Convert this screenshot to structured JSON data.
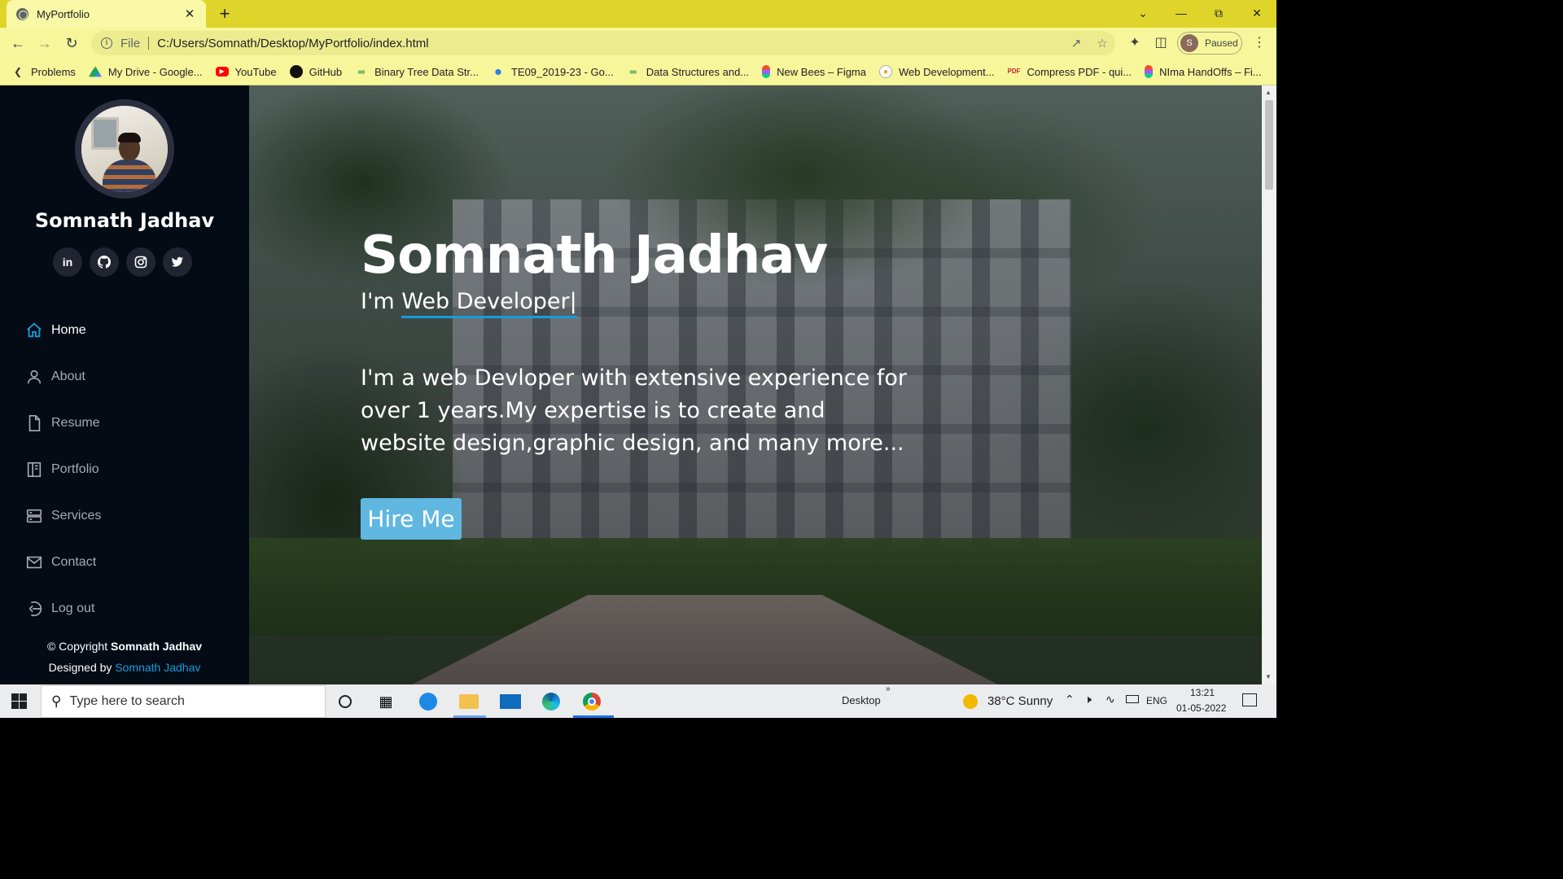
{
  "browser": {
    "tab_title": "MyPortfolio",
    "tab_close": "✕",
    "new_tab": "+",
    "address_scheme": "File",
    "address_url": "C:/Users/Somnath/Desktop/MyPortfolio/index.html",
    "profile_initial": "S",
    "profile_status": "Paused",
    "bookmarks": [
      {
        "label": "Problems",
        "icon": "problems-icon",
        "color": "#333333"
      },
      {
        "label": "My Drive - Google...",
        "icon": "google-drive-icon",
        "color": "#1fa463"
      },
      {
        "label": "YouTube",
        "icon": "youtube-icon",
        "color": "#ff0000"
      },
      {
        "label": "GitHub",
        "icon": "github-icon",
        "color": "#111111"
      },
      {
        "label": "Binary Tree Data Str...",
        "icon": "gfg-icon",
        "color": "#2f8d46"
      },
      {
        "label": "TE09_2019-23 - Go...",
        "icon": "people-icon",
        "color": "#1a73e8"
      },
      {
        "label": "Data Structures and...",
        "icon": "gfg-icon",
        "color": "#2f8d46"
      },
      {
        "label": "New Bees – Figma",
        "icon": "figma-icon",
        "color": "#f24e1e"
      },
      {
        "label": "Web Development...",
        "icon": "web-icon",
        "color": "#e8a317"
      },
      {
        "label": "Compress PDF - qui...",
        "icon": "pdf-icon",
        "color": "#c1272d"
      },
      {
        "label": "NIma HandOffs – Fi...",
        "icon": "figma-icon",
        "color": "#f24e1e"
      }
    ]
  },
  "sidebar": {
    "name": "Somnath Jadhav",
    "socials": [
      "linkedin-icon",
      "github-icon",
      "instagram-icon",
      "twitter-icon"
    ],
    "linkedin_text": "in",
    "menu": [
      {
        "label": "Home",
        "icon": "home-icon",
        "active": true
      },
      {
        "label": "About",
        "icon": "user-icon",
        "active": false
      },
      {
        "label": "Resume",
        "icon": "file-icon",
        "active": false
      },
      {
        "label": "Portfolio",
        "icon": "book-icon",
        "active": false
      },
      {
        "label": "Services",
        "icon": "server-icon",
        "active": false
      },
      {
        "label": "Contact",
        "icon": "envelope-icon",
        "active": false
      },
      {
        "label": "Log out",
        "icon": "logout-icon",
        "active": false
      }
    ],
    "footer": {
      "copyright_prefix": "© Copyright ",
      "copyright_name": "Somnath Jadhav",
      "designed_prefix": "Designed by ",
      "designed_name": "Somnath Jadhav"
    }
  },
  "hero": {
    "title": "Somnath Jadhav",
    "subtitle_prefix": "I'm ",
    "subtitle_typed": "Web Developer|",
    "description": "I'm a web Devloper with extensive experience for over 1 years.My expertise is to create and website design,graphic design, and many more...",
    "cta": "Hire Me"
  },
  "taskbar": {
    "search_placeholder": "Type here to search",
    "desktop_label": "Desktop",
    "weather": "38°C  Sunny",
    "language": "ENG",
    "time": "13:21",
    "date": "01-05-2022"
  },
  "colors": {
    "accent": "#149ddd",
    "sidebar_bg": "#040b14",
    "browser_frame": "#dfd52a"
  }
}
